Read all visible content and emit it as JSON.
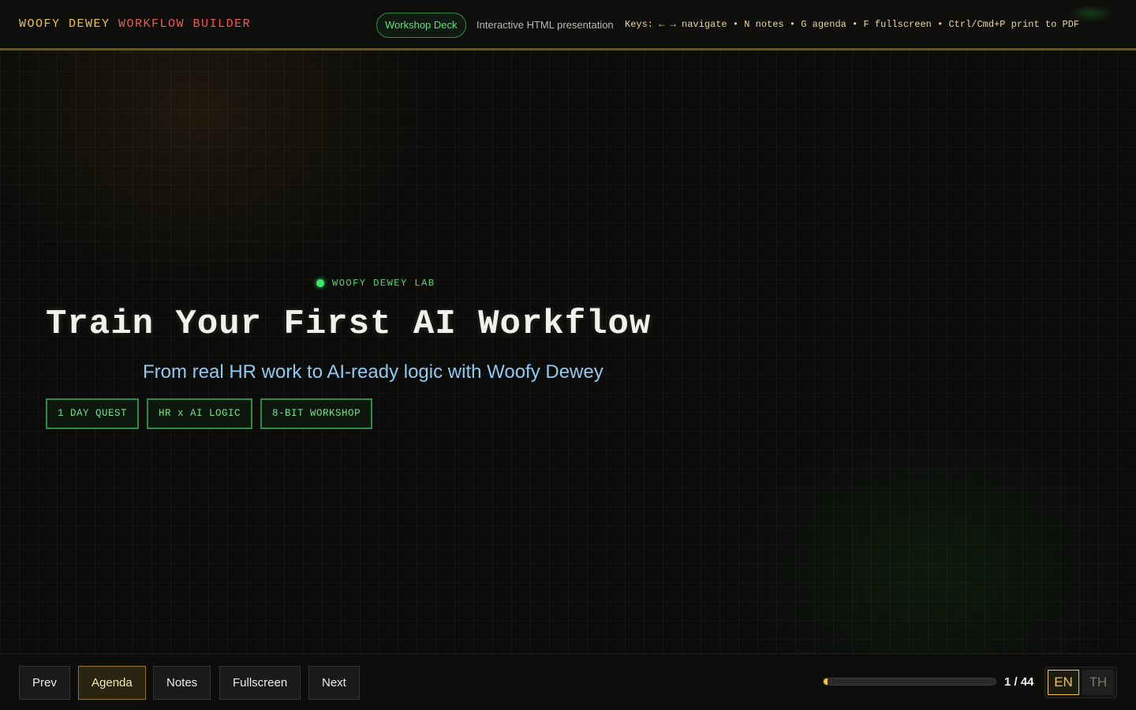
{
  "header": {
    "brand_part1": "WOOFY DEWEY",
    "brand_part2": "WORKFLOW BUILDER",
    "deck_badge": "Workshop Deck",
    "deck_subtitle": "Interactive HTML presentation",
    "keys_hint": "Keys: ← → navigate • N notes • G agenda • F fullscreen • Ctrl/Cmd+P print to PDF"
  },
  "slide": {
    "lab_tag": "WOOFY DEWEY LAB",
    "title": "Train Your First AI Workflow",
    "subtitle": "From real HR work to AI-ready logic with Woofy Dewey",
    "chips": [
      "1 DAY QUEST",
      "HR x AI LOGIC",
      "8-BIT WORKSHOP"
    ]
  },
  "controls": {
    "prev": "Prev",
    "agenda": "Agenda",
    "notes": "Notes",
    "fullscreen": "Fullscreen",
    "next": "Next",
    "counter": "1 / 44",
    "progress_fraction": 0.0227,
    "lang_en": "EN",
    "lang_th": "TH",
    "active_lang": "EN"
  },
  "colors": {
    "accent_gold": "#f0c53a",
    "accent_red": "#ef5a5a",
    "accent_green": "#3ee86a",
    "subtitle_blue": "#8fc9f0"
  }
}
